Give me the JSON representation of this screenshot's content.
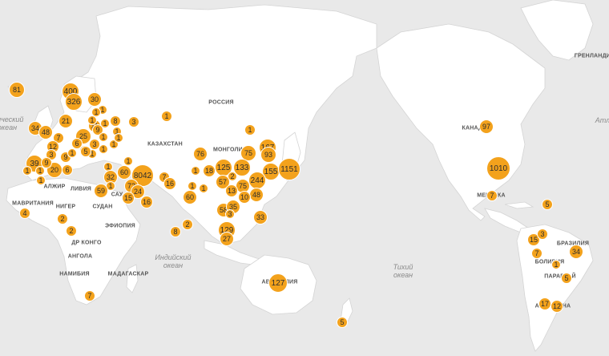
{
  "map": {
    "colors": {
      "land": "#ffffff",
      "water": "#e9e9e9",
      "border": "#d4d4d4",
      "marker": "#f3a21c",
      "marker_text": "#2d2d2d"
    },
    "region_labels": [
      {
        "id": "greenland",
        "text": "ГРЕНЛАНДИЯ"
      },
      {
        "id": "russia",
        "text": "РОССИЯ"
      },
      {
        "id": "kazakhstan",
        "text": "КАЗАХСТАН"
      },
      {
        "id": "mongolia",
        "text": "МОНГОЛИЯ"
      },
      {
        "id": "algeria",
        "text": "АЛЖИР"
      },
      {
        "id": "libya",
        "text": "ЛИВИЯ"
      },
      {
        "id": "mauritania",
        "text": "МАВРИТАНИЯ"
      },
      {
        "id": "niger",
        "text": "НИГЕР"
      },
      {
        "id": "sudan",
        "text": "СУДАН"
      },
      {
        "id": "ethiopia",
        "text": "ЭФИОПИЯ"
      },
      {
        "id": "drc",
        "text": "ДР КОНГО"
      },
      {
        "id": "angola",
        "text": "АНГОЛА"
      },
      {
        "id": "namibia",
        "text": "НАМИБИЯ"
      },
      {
        "id": "madagascar",
        "text": "МАДАГАСКАР"
      },
      {
        "id": "australia",
        "text": "АВСТРАЛИЯ"
      },
      {
        "id": "canada",
        "text": "КАНАДА"
      },
      {
        "id": "mexico",
        "text": "МЕКСИКА"
      },
      {
        "id": "brazil",
        "text": "БРАЗИЛИЯ"
      },
      {
        "id": "bolivia",
        "text": "БОЛИВИЯ"
      },
      {
        "id": "paraguay",
        "text": "ПАРАГВАЙ"
      },
      {
        "id": "argentina",
        "text": "АРГЕНТИНА"
      },
      {
        "id": "saudi",
        "text": "САУ"
      }
    ],
    "ocean_labels": [
      {
        "id": "atlantic-west",
        "text": "тический\nокеан"
      },
      {
        "id": "indian",
        "text": "Индийский\nокеан"
      },
      {
        "id": "pacific",
        "text": "Тихий\nокеан"
      },
      {
        "id": "atlantic-east",
        "text": "Атл"
      }
    ],
    "markers": [
      {
        "id": "iceland",
        "value": "81"
      },
      {
        "id": "norway",
        "value": "400"
      },
      {
        "id": "sweden",
        "value": "326"
      },
      {
        "id": "finland",
        "value": "30"
      },
      {
        "id": "denmark",
        "value": "21"
      },
      {
        "id": "ireland",
        "value": "34"
      },
      {
        "id": "uk",
        "value": "48"
      },
      {
        "id": "netherlands",
        "value": "7"
      },
      {
        "id": "belgium",
        "value": "12"
      },
      {
        "id": "germany",
        "value": "25"
      },
      {
        "id": "poland",
        "value": "11"
      },
      {
        "id": "czech",
        "value": "6"
      },
      {
        "id": "austria",
        "value": "5"
      },
      {
        "id": "switzerland",
        "value": "9"
      },
      {
        "id": "france",
        "value": "9"
      },
      {
        "id": "spain",
        "value": "39"
      },
      {
        "id": "portugal",
        "value": "1"
      },
      {
        "id": "italy",
        "value": "20"
      },
      {
        "id": "greece",
        "value": "6"
      },
      {
        "id": "estonia",
        "value": "1"
      },
      {
        "id": "latvia",
        "value": "1"
      },
      {
        "id": "lithuania",
        "value": "1"
      },
      {
        "id": "belarus",
        "value": "1"
      },
      {
        "id": "ukraine",
        "value": "9"
      },
      {
        "id": "russia-west",
        "value": "8"
      },
      {
        "id": "moscow",
        "value": "3"
      },
      {
        "id": "russia-mid",
        "value": "1"
      },
      {
        "id": "romania",
        "value": "3"
      },
      {
        "id": "hungary",
        "value": "1"
      },
      {
        "id": "croatia",
        "value": "1"
      },
      {
        "id": "serbia",
        "value": "1"
      },
      {
        "id": "slovenia",
        "value": "5"
      },
      {
        "id": "bulgaria",
        "value": "1"
      },
      {
        "id": "georgia",
        "value": "1"
      },
      {
        "id": "armenia",
        "value": "1"
      },
      {
        "id": "turkey",
        "value": "1"
      },
      {
        "id": "azerbaijan",
        "value": "1"
      },
      {
        "id": "malta",
        "value": "1"
      },
      {
        "id": "tunisia",
        "value": "3"
      },
      {
        "id": "morocco",
        "value": "1"
      },
      {
        "id": "israel",
        "value": "32"
      },
      {
        "id": "lebanon",
        "value": "1"
      },
      {
        "id": "egypt",
        "value": "59"
      },
      {
        "id": "iraq",
        "value": "60"
      },
      {
        "id": "iran",
        "value": "8042"
      },
      {
        "id": "kuwait",
        "value": "72"
      },
      {
        "id": "bahrain",
        "value": "24"
      },
      {
        "id": "saudi-arabia",
        "value": "15"
      },
      {
        "id": "uae",
        "value": "16"
      },
      {
        "id": "afghanistan",
        "value": "7"
      },
      {
        "id": "pakistan",
        "value": "16"
      },
      {
        "id": "russia-siberia",
        "value": "1"
      },
      {
        "id": "russia-east",
        "value": "1"
      },
      {
        "id": "kazakhstan-east",
        "value": "76"
      },
      {
        "id": "mongolia-w",
        "value": "1"
      },
      {
        "id": "india",
        "value": "60"
      },
      {
        "id": "india-n",
        "value": "1"
      },
      {
        "id": "nepal",
        "value": "1"
      },
      {
        "id": "sri-lanka",
        "value": "2"
      },
      {
        "id": "maldives",
        "value": "8"
      },
      {
        "id": "bhutan",
        "value": "18"
      },
      {
        "id": "china-w",
        "value": "125"
      },
      {
        "id": "china-n",
        "value": "75"
      },
      {
        "id": "china-ne",
        "value": "167"
      },
      {
        "id": "korea-n",
        "value": "93"
      },
      {
        "id": "korea",
        "value": "155"
      },
      {
        "id": "japan",
        "value": "1151"
      },
      {
        "id": "china-mid",
        "value": "133"
      },
      {
        "id": "china-c",
        "value": "2"
      },
      {
        "id": "china-e",
        "value": "244"
      },
      {
        "id": "china-sw",
        "value": "57"
      },
      {
        "id": "china-s",
        "value": "75"
      },
      {
        "id": "myanmar",
        "value": "13"
      },
      {
        "id": "hongkong",
        "value": "48"
      },
      {
        "id": "taiwan",
        "value": "10"
      },
      {
        "id": "thailand",
        "value": "58"
      },
      {
        "id": "vietnam",
        "value": "35"
      },
      {
        "id": "cambodia",
        "value": "3"
      },
      {
        "id": "philippines",
        "value": "33"
      },
      {
        "id": "malaysia",
        "value": "129"
      },
      {
        "id": "singapore",
        "value": "27"
      },
      {
        "id": "australia",
        "value": "127"
      },
      {
        "id": "new-zealand",
        "value": "5"
      },
      {
        "id": "canada",
        "value": "97"
      },
      {
        "id": "usa",
        "value": "1010"
      },
      {
        "id": "mexico",
        "value": "7"
      },
      {
        "id": "dominican",
        "value": "5"
      },
      {
        "id": "colombia",
        "value": "15"
      },
      {
        "id": "venezuela",
        "value": "3"
      },
      {
        "id": "ecuador",
        "value": "7"
      },
      {
        "id": "peru",
        "value": "1"
      },
      {
        "id": "brazil",
        "value": "34"
      },
      {
        "id": "paraguay",
        "value": "5"
      },
      {
        "id": "chile",
        "value": "17"
      },
      {
        "id": "argentina",
        "value": "12"
      },
      {
        "id": "senegal",
        "value": "4"
      },
      {
        "id": "nigeria",
        "value": "2"
      },
      {
        "id": "cameroon",
        "value": "2"
      },
      {
        "id": "south-africa",
        "value": "7"
      },
      {
        "id": "tanzania",
        "value": "2"
      },
      {
        "id": "algeria",
        "value": "9"
      }
    ]
  }
}
